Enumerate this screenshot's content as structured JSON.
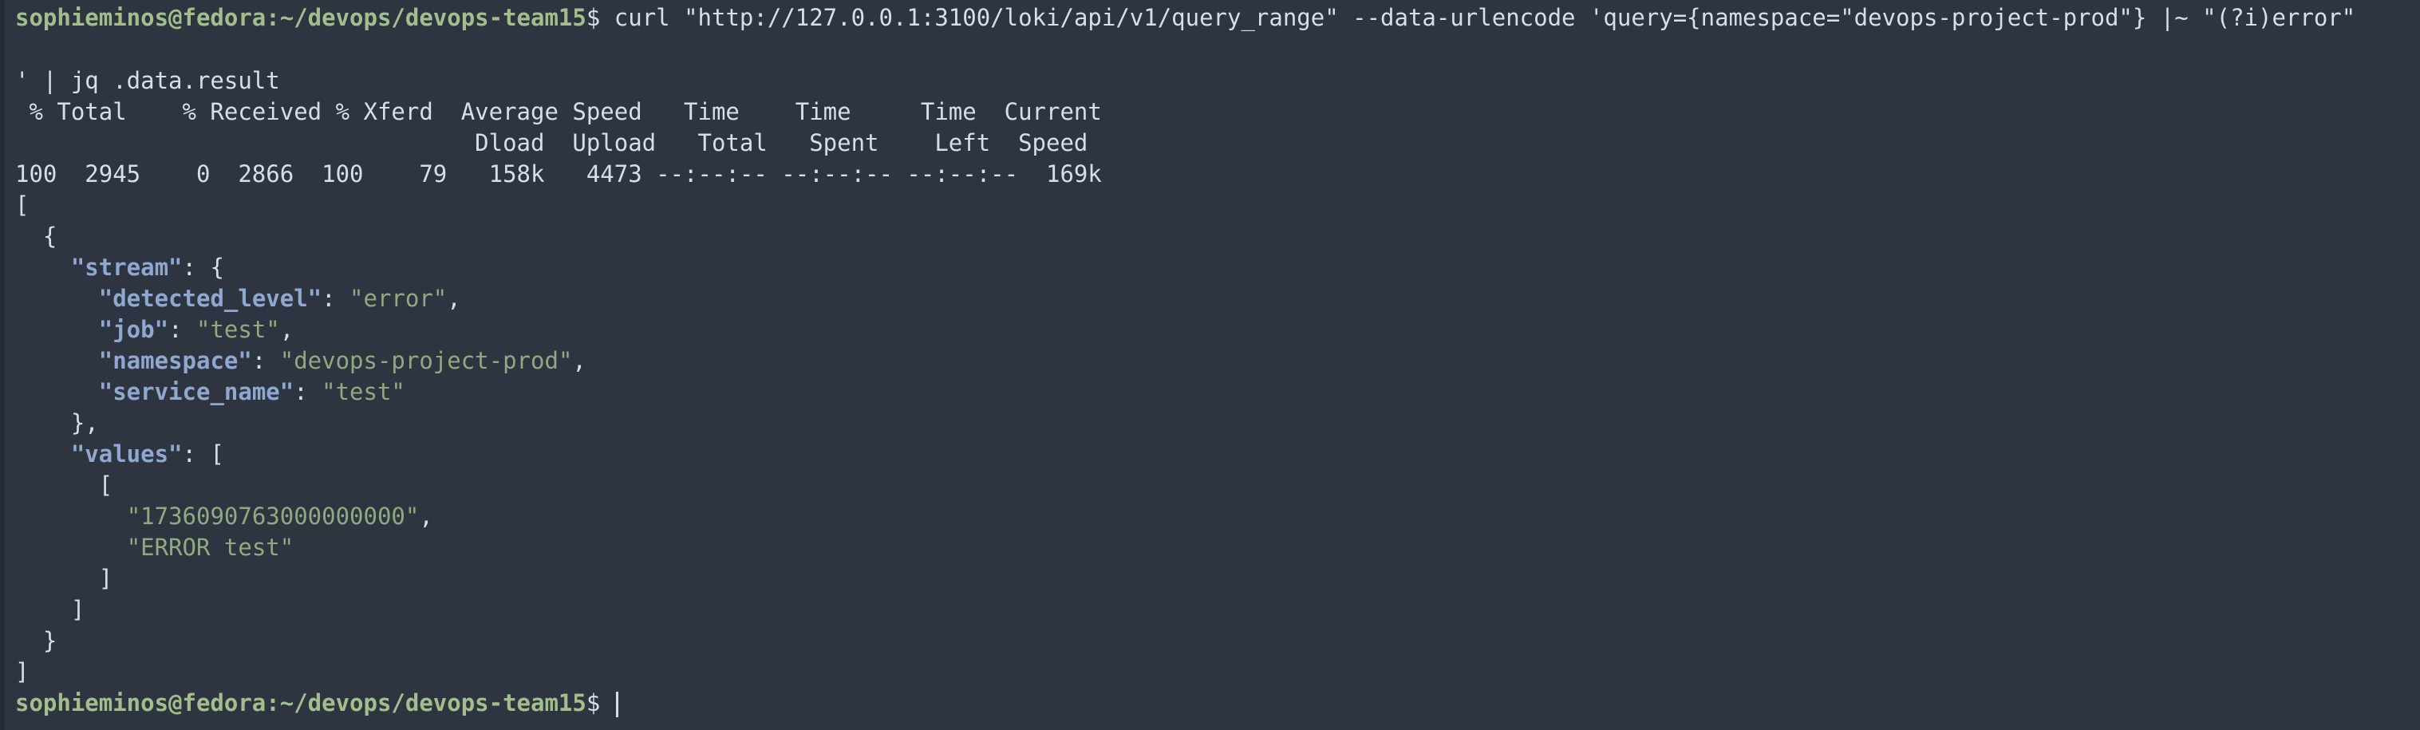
{
  "window": {
    "prompt": {
      "user_host": "sophieminos@fedora",
      "path": ":~/devops/devops-team15",
      "symbol": "$ "
    },
    "command": {
      "line1": "curl \"http://127.0.0.1:3100/loki/api/v1/query_range\" --data-urlencode 'query={namespace=\"devops-project-prod\"} |~ \"(?i)error\"",
      "line2": "' | jq .data.result"
    },
    "curl_progress": {
      "header1": " % Total    % Received % Xferd  Average Speed   Time    Time     Time  Current",
      "header2": "                                 Dload  Upload   Total   Spent    Left  Speed",
      "row": "100  2945    0  2866  100    79   158k   4473 --:--:-- --:--:-- --:--:--  169k"
    },
    "output": {
      "open_bracket": "[",
      "open_obj": "  {",
      "stream_key": "\"stream\"",
      "stream_open": ": {",
      "fields": [
        {
          "key": "\"detected_level\"",
          "value": "\"error\"",
          "trail": ","
        },
        {
          "key": "\"job\"",
          "value": "\"test\"",
          "trail": ","
        },
        {
          "key": "\"namespace\"",
          "value": "\"devops-project-prod\"",
          "trail": ","
        },
        {
          "key": "\"service_name\"",
          "value": "\"test\"",
          "trail": ""
        }
      ],
      "stream_close": "    },",
      "values_key": "\"values\"",
      "values_open": ": [",
      "inner_open": "      [",
      "value_items": [
        {
          "value": "\"1736090763000000000\"",
          "trail": ","
        },
        {
          "value": "\"ERROR test\"",
          "trail": ""
        }
      ],
      "inner_close": "      ]",
      "values_close": "    ]",
      "close_obj": "  }",
      "close_bracket": "]"
    },
    "final_prompt": {
      "user_host": "sophieminos@fedora",
      "path": ":~/devops/devops-team15",
      "symbol": "$ "
    }
  }
}
